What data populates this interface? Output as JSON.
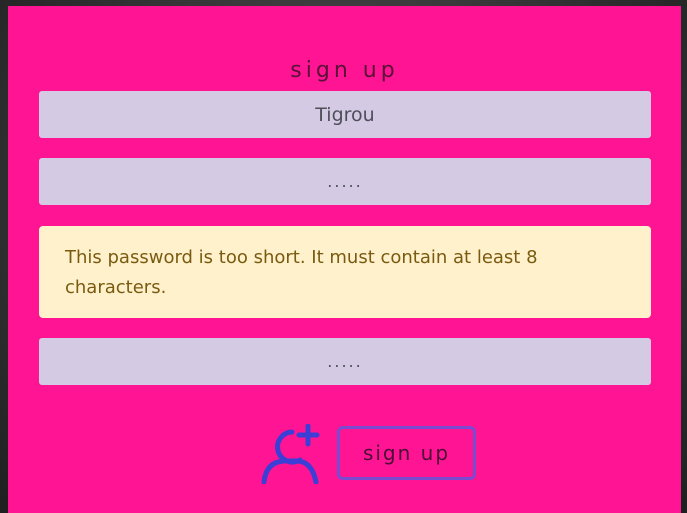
{
  "form": {
    "title": "sign up",
    "username_value": "Tigrou",
    "password_value": ".....",
    "password_error": "This password is too short. It must contain at least 8 characters.",
    "confirm_value": ".....",
    "submit_label": "sign up",
    "submit_icon": "user-plus-icon"
  },
  "colors": {
    "panel_bg": "#ff1493",
    "field_bg": "#d4cae3",
    "alert_bg": "#fff1cb",
    "alert_text": "#7a5a10",
    "icon": "#3b3fd6",
    "button_border": "#7a4ad0"
  }
}
